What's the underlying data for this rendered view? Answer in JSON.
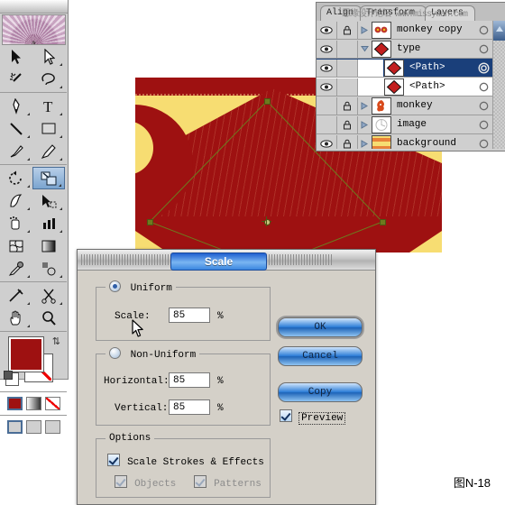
{
  "toolbox": {
    "title": "toolbox",
    "tools": [
      {
        "name": "selection-tool",
        "label": "Selection"
      },
      {
        "name": "direct-selection-tool",
        "label": "Direct Selection"
      },
      {
        "name": "magic-wand-tool",
        "label": "Magic Wand"
      },
      {
        "name": "lasso-tool",
        "label": "Lasso"
      },
      {
        "name": "pen-tool",
        "label": "Pen"
      },
      {
        "name": "type-tool",
        "label": "Type"
      },
      {
        "name": "line-segment-tool",
        "label": "Line Segment"
      },
      {
        "name": "rectangle-tool",
        "label": "Rectangle"
      },
      {
        "name": "paintbrush-tool",
        "label": "Paintbrush"
      },
      {
        "name": "pencil-tool",
        "label": "Pencil"
      },
      {
        "name": "rotate-tool",
        "label": "Rotate"
      },
      {
        "name": "scale-tool",
        "label": "Scale"
      },
      {
        "name": "warp-tool",
        "label": "Warp"
      },
      {
        "name": "free-transform-tool",
        "label": "Free Transform"
      },
      {
        "name": "symbol-sprayer-tool",
        "label": "Symbol Sprayer"
      },
      {
        "name": "column-graph-tool",
        "label": "Column Graph"
      },
      {
        "name": "mesh-tool",
        "label": "Mesh"
      },
      {
        "name": "gradient-tool",
        "label": "Gradient"
      },
      {
        "name": "eyedropper-tool",
        "label": "Eyedropper"
      },
      {
        "name": "blend-tool",
        "label": "Blend"
      },
      {
        "name": "slice-tool",
        "label": "Slice"
      },
      {
        "name": "scissors-tool",
        "label": "Scissors"
      },
      {
        "name": "hand-tool",
        "label": "Hand"
      },
      {
        "name": "zoom-tool",
        "label": "Zoom"
      }
    ],
    "selected_tool": "scale-tool",
    "fill_color": "#9e1111",
    "stroke_color": "#ffffff",
    "stroke_none": true,
    "paint_modes": [
      "color",
      "gradient",
      "none"
    ],
    "paint_mode_selected": "color",
    "screen_modes": [
      "standard-screen",
      "full-screen-menubar",
      "full-screen"
    ],
    "screen_mode_selected": "standard-screen"
  },
  "artwork": {
    "background_color": "#f7dd72",
    "shape_color": "#9e1111",
    "selection_color": "#6d7a1e",
    "anchors": 4,
    "has_center_point": true
  },
  "layers_panel": {
    "tabs": [
      {
        "label": "Align",
        "active": false
      },
      {
        "label": "Transform",
        "active": false
      },
      {
        "label": "Layers",
        "active": true
      }
    ],
    "watermark": "思缘设计论坛 www.missyuan.com",
    "rows": [
      {
        "name": "monkey copy",
        "indent": 0,
        "visible": true,
        "locked": false,
        "expandable": true,
        "expanded": false,
        "selected": false,
        "targeted": false,
        "thumb": "monkey-thumb",
        "has_color_square": false
      },
      {
        "name": "type",
        "indent": 0,
        "visible": true,
        "locked": false,
        "expandable": true,
        "expanded": true,
        "selected": false,
        "targeted": false,
        "thumb": "diamond-thumb",
        "has_color_square": true
      },
      {
        "name": "<Path>",
        "indent": 1,
        "visible": true,
        "locked": false,
        "expandable": false,
        "expanded": false,
        "selected": true,
        "targeted": true,
        "thumb": "diamond-thumb",
        "has_color_square": true
      },
      {
        "name": "<Path>",
        "indent": 1,
        "visible": true,
        "locked": false,
        "expandable": false,
        "expanded": false,
        "selected": false,
        "targeted": false,
        "thumb": "diamond-thumb",
        "has_color_square": false
      },
      {
        "name": "monkey",
        "indent": 0,
        "visible": false,
        "locked": true,
        "expandable": true,
        "expanded": false,
        "selected": false,
        "targeted": false,
        "thumb": "monkey-thumb",
        "has_color_square": false
      },
      {
        "name": "image",
        "indent": 0,
        "visible": false,
        "locked": true,
        "expandable": true,
        "expanded": false,
        "selected": false,
        "targeted": false,
        "thumb": "image-thumb",
        "has_color_square": false
      },
      {
        "name": "background",
        "indent": 0,
        "visible": true,
        "locked": true,
        "expandable": true,
        "expanded": false,
        "selected": false,
        "targeted": false,
        "thumb": "background-thumb",
        "has_color_square": false
      }
    ]
  },
  "scale_dialog": {
    "title": "Scale",
    "uniform": {
      "legend": "Uniform",
      "selected": true,
      "scale_label": "Scale:",
      "scale_value": "85",
      "scale_unit": "%"
    },
    "non_uniform": {
      "legend": "Non-Uniform",
      "selected": false,
      "horizontal_label": "Horizontal:",
      "horizontal_value": "85",
      "horizontal_unit": "%",
      "vertical_label": "Vertical:",
      "vertical_value": "85",
      "vertical_unit": "%"
    },
    "options": {
      "legend": "Options",
      "scale_strokes_label": "Scale Strokes & Effects",
      "scale_strokes_checked": true,
      "objects_label": "Objects",
      "objects_checked": true,
      "objects_disabled": true,
      "patterns_label": "Patterns",
      "patterns_checked": true,
      "patterns_disabled": true
    },
    "buttons": {
      "ok": "OK",
      "cancel": "Cancel",
      "copy": "Copy"
    },
    "preview": {
      "label": "Preview",
      "checked": true
    }
  },
  "caption": "图N-18"
}
